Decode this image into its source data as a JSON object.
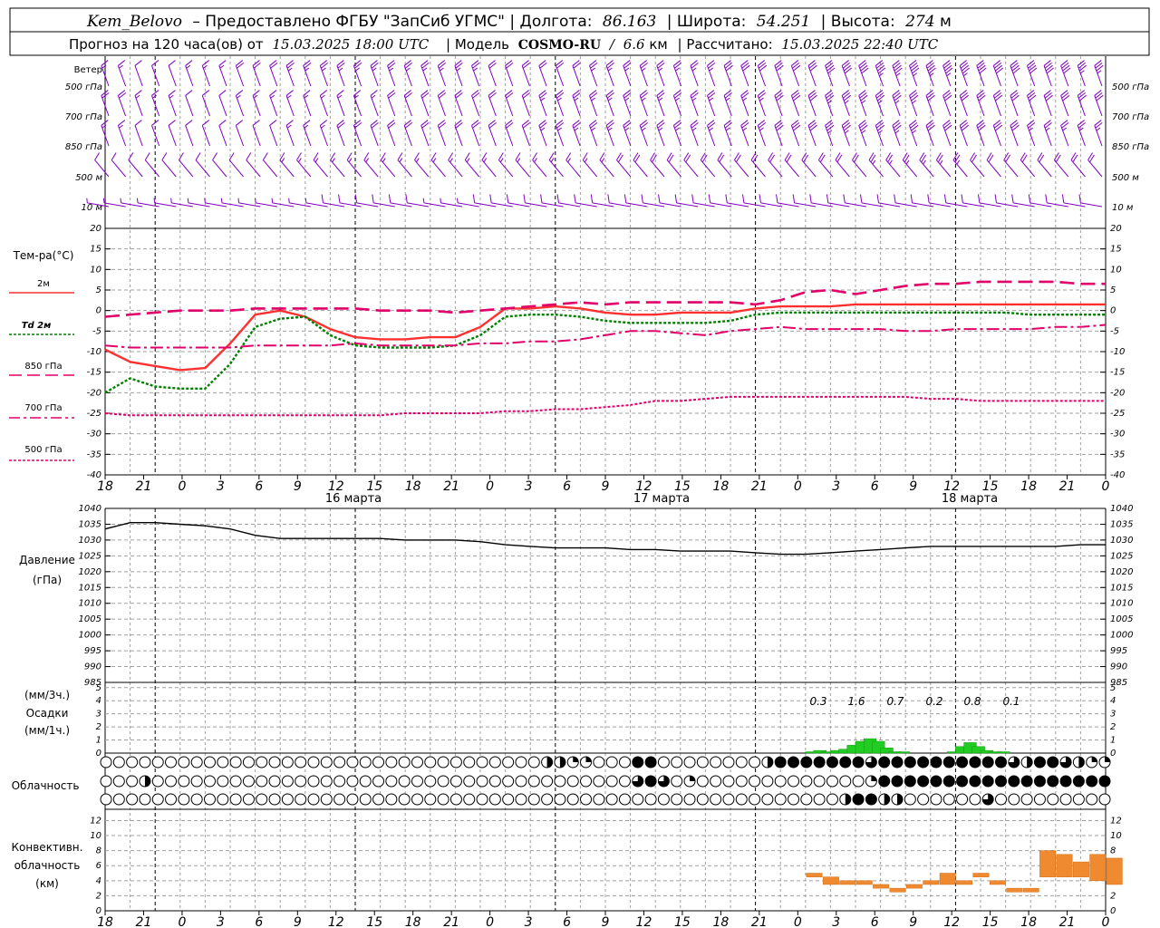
{
  "header": {
    "station": "Kem_Belovo",
    "provided": "– Предоставлено ФГБУ \"ЗапСиб УГМС\" | Долгота:",
    "lon": "86.163",
    "lat_label": "| Широта:",
    "lat": "54.251",
    "alt_label": "| Высота:",
    "alt": "274",
    "alt_unit": "м",
    "forecast_label": "Прогноз на 120 часа(ов) от",
    "init_time": "15.03.2025 18:00 UTC",
    "model_label": "| Модель",
    "model": "COSMO-RU",
    "res_sep": "/",
    "res": "6.6",
    "res_unit": "км",
    "calc_label": "| Рассчитано:",
    "calc_time": "15.03.2025 22:40 UTC"
  },
  "wind_panel": {
    "title": "Ветер",
    "levels": [
      "500 гПа",
      "700 гПа",
      "850 гПа",
      "500 м",
      "10 м"
    ],
    "color": "#8000c0"
  },
  "temp_panel": {
    "title": "Тем-ра(°C)",
    "yticks": [
      "20",
      "15",
      "10",
      "5",
      "0",
      "-5",
      "-10",
      "-15",
      "-20",
      "-25",
      "-30",
      "-35",
      "-40"
    ],
    "legend": [
      {
        "label": "2м",
        "color": "#ff3030"
      },
      {
        "label": "Td 2м",
        "color": "#008000"
      },
      {
        "label": "850 гПа",
        "color": "#e0006a"
      },
      {
        "label": "700 гПа",
        "color": "#e0006a"
      },
      {
        "label": "500 гПа",
        "color": "#e0006a"
      }
    ]
  },
  "pressure_panel": {
    "title1": "Давление",
    "title2": "(гПа)",
    "yticks": [
      "1040",
      "1035",
      "1030",
      "1025",
      "1020",
      "1015",
      "1010",
      "1005",
      "1000",
      "995",
      "990",
      "985"
    ]
  },
  "precip_panel": {
    "unit3h": "(мм/3ч.)",
    "title": "Осадки",
    "unit1h": "(мм/1ч.)",
    "yticks": [
      "5",
      "4",
      "3",
      "2",
      "1",
      "0"
    ],
    "totals": [
      "0.3",
      "1.6",
      "0.7",
      "0.2",
      "0.8",
      "0.1"
    ]
  },
  "cloud_panel": {
    "title": "Облачность"
  },
  "conv_panel": {
    "title1": "Конвективн.",
    "title2": "облачность",
    "title3": "(км)",
    "yticks": [
      "12",
      "10",
      "8",
      "6",
      "4",
      "2",
      "0"
    ],
    "color": "#f08a30"
  },
  "x_axis": {
    "ticks": [
      "18",
      "21",
      "0",
      "3",
      "6",
      "9",
      "12",
      "15",
      "18",
      "21",
      "0",
      "3",
      "6",
      "9",
      "12",
      "15",
      "18",
      "21",
      "0",
      "3",
      "6",
      "9",
      "12",
      "15",
      "18",
      "21",
      "0"
    ],
    "days": [
      "16 марта",
      "17 марта",
      "18 марта"
    ]
  },
  "chart_data": {
    "type": "line",
    "x_hours": [
      0,
      3,
      6,
      9,
      12,
      15,
      18,
      21,
      24,
      27,
      30,
      33,
      36,
      39,
      42,
      45,
      48,
      51,
      54,
      57,
      60,
      63,
      66,
      69,
      72,
      75,
      78,
      81,
      84,
      87,
      90,
      93,
      96,
      99,
      102,
      105,
      108,
      111,
      114,
      117,
      120
    ],
    "series": [
      {
        "name": "2м",
        "values": [
          -9.5,
          -12.5,
          -13.5,
          -14.5,
          -14,
          -8,
          -1,
          0,
          -1.5,
          -4.5,
          -6.5,
          -7,
          -7,
          -6.5,
          -6.5,
          -4,
          0.5,
          0.5,
          1,
          0.5,
          -0.5,
          -1,
          -1,
          -0.5,
          -0.5,
          -0.5,
          0.5,
          1,
          1,
          1,
          1.5,
          1.5,
          1.5,
          1.5,
          1.5,
          1.5,
          1.5,
          1.5,
          1.5,
          1.5,
          1.5
        ]
      },
      {
        "name": "Td 2м",
        "values": [
          -20,
          -16.5,
          -18.5,
          -19,
          -19,
          -13,
          -4,
          -2,
          -1.5,
          -6,
          -8.5,
          -9,
          -9,
          -9,
          -8.5,
          -6,
          -1.5,
          -1,
          -1,
          -1.5,
          -2.5,
          -3,
          -3,
          -3,
          -3,
          -2.5,
          -1,
          -0.5,
          -0.5,
          -0.5,
          -0.5,
          -0.5,
          -0.5,
          -0.5,
          -0.5,
          -0.5,
          -0.5,
          -1,
          -1,
          -1,
          -1
        ]
      },
      {
        "name": "850 гПа",
        "values": [
          -1.5,
          -1,
          -0.5,
          0,
          0,
          0,
          0.5,
          0.5,
          0.5,
          0.5,
          0.5,
          0,
          0,
          0,
          -0.5,
          0,
          0.5,
          1,
          1.5,
          2,
          1.5,
          2,
          2,
          2,
          2,
          2,
          1.5,
          2.5,
          4.5,
          5,
          4,
          5,
          6,
          6.5,
          6.5,
          7,
          7,
          7,
          7,
          6.5,
          6.5
        ]
      },
      {
        "name": "700 гПа",
        "values": [
          -8.5,
          -9,
          -9,
          -9,
          -9,
          -9,
          -8.5,
          -8.5,
          -8.5,
          -8.5,
          -8,
          -8.5,
          -8.5,
          -8.5,
          -8.5,
          -8,
          -8,
          -7.5,
          -7.5,
          -7,
          -6,
          -5,
          -5,
          -5.5,
          -6,
          -5,
          -4.5,
          -4,
          -4.5,
          -4.5,
          -4.5,
          -4.5,
          -5,
          -5,
          -4.5,
          -4.5,
          -4.5,
          -4.5,
          -4,
          -4,
          -3.5
        ]
      },
      {
        "name": "500 гПа",
        "values": [
          -25,
          -25.5,
          -25.5,
          -25.5,
          -25.5,
          -25.5,
          -25.5,
          -25.5,
          -25.5,
          -25.5,
          -25.5,
          -25.5,
          -25,
          -25,
          -25,
          -25,
          -24.5,
          -24.5,
          -24,
          -24,
          -23.5,
          -23,
          -22,
          -22,
          -21.5,
          -21,
          -21,
          -21,
          -21,
          -21,
          -21,
          -21,
          -21,
          -21.5,
          -21.5,
          -22,
          -22,
          -22,
          -22,
          -22,
          -22
        ]
      },
      {
        "name": "Давление",
        "values": [
          1033.5,
          1035.5,
          1035.5,
          1035,
          1034.5,
          1033.5,
          1031.5,
          1030.5,
          1030.5,
          1030.5,
          1030.5,
          1030.5,
          1030,
          1030,
          1030,
          1029.5,
          1028.5,
          1028,
          1027.5,
          1027.5,
          1027.5,
          1027,
          1027,
          1026.5,
          1026.5,
          1026.5,
          1026,
          1025.5,
          1025.5,
          1026,
          1026.5,
          1027,
          1027.5,
          1028,
          1028,
          1028,
          1028,
          1028,
          1028,
          1028.5,
          1028.5
        ]
      }
    ],
    "precip_hourly": {
      "hours": [
        84,
        85,
        86,
        87,
        88,
        89,
        90,
        91,
        92,
        93,
        94,
        95,
        96,
        97,
        98,
        99,
        100,
        101,
        102,
        103,
        104,
        105,
        106,
        107,
        108
      ],
      "values": [
        0.1,
        0.2,
        0.1,
        0.2,
        0.3,
        0.6,
        0.9,
        1.1,
        0.9,
        0.4,
        0.1,
        0.1,
        0,
        0,
        0,
        0,
        0,
        0.1,
        0.5,
        0.8,
        0.5,
        0.2,
        0.1,
        0.1,
        0
      ]
    },
    "cloud_layers": {
      "hours": [
        0,
        1,
        2,
        3,
        4,
        5,
        6,
        7,
        8,
        9,
        10,
        11,
        12,
        13,
        14,
        15,
        16,
        17,
        18,
        19,
        20,
        21,
        22,
        23,
        24,
        25,
        26,
        27,
        28,
        29,
        30,
        31,
        32,
        33,
        34,
        35,
        36,
        37,
        38,
        39,
        40,
        41,
        42,
        43,
        44,
        45,
        46,
        47,
        48,
        49,
        50,
        51,
        52,
        53,
        54,
        55,
        56,
        57,
        58,
        59,
        60,
        61,
        62,
        63,
        64,
        65,
        66,
        67,
        68,
        69,
        70,
        71,
        72,
        73,
        74,
        75,
        76,
        77,
        78,
        79,
        80,
        81,
        82,
        83,
        84,
        85,
        86,
        87,
        88,
        89,
        90,
        91,
        92,
        93,
        94,
        95,
        96,
        97,
        98,
        99,
        100,
        101,
        102,
        103,
        104,
        105,
        106,
        107,
        108,
        109,
        110,
        111,
        112,
        113,
        114,
        115,
        116,
        117,
        118,
        119,
        120
      ],
      "upper": [
        0,
        0,
        0,
        0,
        0,
        0,
        0,
        0,
        0,
        0,
        0,
        0,
        0,
        0,
        0,
        0,
        0,
        0,
        0,
        0,
        0,
        0,
        0,
        0,
        0,
        0,
        0,
        0,
        0,
        0,
        0,
        0,
        0,
        0,
        0,
        0,
        0,
        0,
        0,
        0,
        0,
        0,
        0,
        0,
        0,
        0,
        0,
        0,
        0,
        0,
        0,
        0,
        0.75,
        0.5,
        0.25,
        0.5,
        0.25,
        0,
        0.25,
        0,
        0.25,
        0,
        0,
        0.75,
        1,
        1,
        0,
        0,
        0,
        0,
        0,
        0,
        0,
        0,
        0,
        0,
        0,
        0,
        0,
        0.5,
        0,
        1,
        1,
        1,
        1,
        1,
        1,
        1,
        1,
        1,
        1,
        1,
        0.75,
        1,
        1,
        1,
        0.75,
        1,
        1,
        1,
        1,
        1,
        0.5,
        1,
        1,
        1,
        1,
        1,
        1,
        0.75,
        1,
        0.5,
        1,
        1,
        1,
        0.75,
        0.5,
        0.5,
        0.25,
        0.75,
        0.25
      ],
      "middle": [
        0,
        0,
        0,
        0,
        0,
        0.5,
        0,
        0,
        0,
        0,
        0,
        0,
        0,
        0,
        0,
        0,
        0,
        0,
        0,
        0,
        0,
        0,
        0,
        0,
        0,
        0,
        0,
        0,
        0,
        0,
        0,
        0,
        0,
        0,
        0,
        0,
        0,
        0,
        0,
        0,
        0,
        0,
        0,
        0,
        0,
        0,
        0,
        0,
        0,
        0,
        0,
        0,
        0,
        0,
        0,
        0,
        0,
        0,
        0,
        0,
        0,
        0,
        0,
        0,
        0.75,
        1,
        0.5,
        0.75,
        0.25,
        0,
        0.25,
        0,
        0,
        0,
        0,
        0,
        0,
        0,
        0,
        0,
        0,
        0,
        0,
        0,
        0,
        0,
        0,
        0,
        0,
        0,
        0,
        0,
        0.25,
        1,
        1,
        1,
        1,
        1,
        1,
        1,
        1,
        1,
        1,
        1,
        1,
        1,
        1,
        1,
        1,
        1,
        1,
        1,
        1,
        1,
        1,
        1,
        1,
        1,
        1
      ],
      "lower": [
        0,
        0,
        0,
        0,
        0,
        0,
        0,
        0,
        0,
        0,
        0,
        0,
        0,
        0,
        0,
        0,
        0,
        0,
        0,
        0,
        0,
        0,
        0,
        0,
        0,
        0,
        0,
        0,
        0,
        0,
        0,
        0,
        0,
        0,
        0,
        0,
        0,
        0,
        0,
        0,
        0,
        0,
        0,
        0,
        0,
        0,
        0,
        0,
        0,
        0,
        0,
        0,
        0,
        0,
        0,
        0,
        0,
        0,
        0,
        0,
        0,
        0,
        0,
        0,
        0,
        0,
        0,
        0,
        0,
        0,
        0,
        0,
        0,
        0,
        0,
        0,
        0,
        0,
        0,
        0,
        0,
        0,
        0,
        0,
        0,
        0,
        0,
        0,
        0,
        0.5,
        1,
        1,
        1,
        1,
        0.5,
        0.5,
        0,
        0,
        0,
        0,
        0,
        0,
        0,
        0,
        0,
        0.5,
        0.75,
        0,
        0,
        0,
        0,
        0,
        0,
        0,
        0,
        0,
        0,
        0,
        0,
        0,
        0
      ]
    },
    "convective": {
      "hours": [
        84,
        86,
        88,
        90,
        92,
        94,
        96,
        98,
        100,
        102,
        104,
        106,
        108,
        110,
        112,
        114,
        116,
        118,
        120
      ],
      "top": [
        5,
        4.5,
        4,
        4,
        3.5,
        3,
        3.5,
        4,
        5,
        4,
        5,
        4,
        3,
        3,
        8,
        7.5,
        6.5,
        7.5,
        7
      ],
      "base": [
        4.5,
        3.5,
        3.5,
        3.5,
        3,
        2.5,
        3,
        3.5,
        3.5,
        3.5,
        4.5,
        3.5,
        2.5,
        2.5,
        4.5,
        4.5,
        4.5,
        4,
        3.5
      ]
    },
    "wind": {
      "hours": [
        0,
        6,
        12,
        18,
        24,
        30,
        36,
        42,
        48,
        54,
        60,
        66,
        72,
        78,
        84,
        90,
        96,
        102,
        108,
        114,
        120
      ],
      "speed_500hPa": [
        15,
        10,
        15,
        20,
        25,
        25,
        25,
        25,
        20,
        20,
        25,
        25,
        25,
        30,
        30,
        40,
        45,
        45,
        40,
        40,
        35
      ],
      "speed_700hPa": [
        20,
        15,
        10,
        15,
        15,
        15,
        20,
        20,
        20,
        25,
        25,
        25,
        25,
        25,
        30,
        35,
        35,
        30,
        30,
        30,
        30
      ],
      "speed_850hPa": [
        15,
        10,
        10,
        10,
        15,
        20,
        20,
        20,
        20,
        25,
        25,
        25,
        25,
        25,
        30,
        35,
        35,
        30,
        30,
        25,
        25
      ],
      "speed_500m": [
        10,
        10,
        10,
        10,
        15,
        15,
        15,
        15,
        15,
        15,
        15,
        20,
        20,
        20,
        20,
        20,
        25,
        25,
        20,
        20,
        20
      ],
      "speed_10m": [
        5,
        5,
        5,
        5,
        5,
        10,
        10,
        5,
        10,
        10,
        10,
        10,
        10,
        10,
        10,
        10,
        10,
        10,
        10,
        10,
        10
      ]
    }
  }
}
